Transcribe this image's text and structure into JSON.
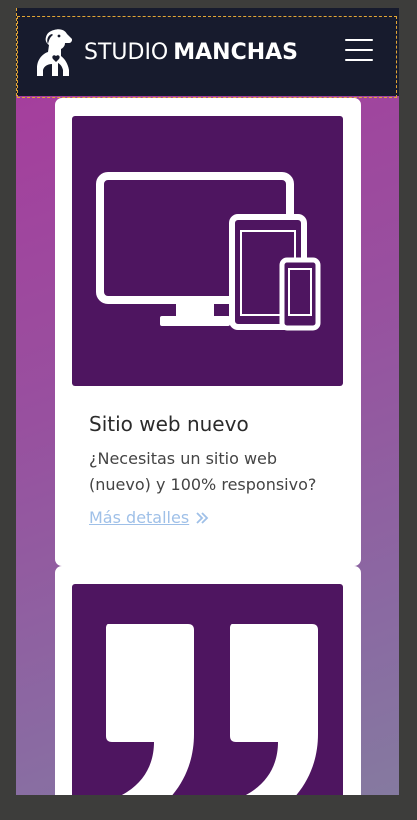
{
  "navbar": {
    "brand_light": "STUDIO",
    "brand_bold": "MANCHAS",
    "menu_icon": "hamburger-menu-icon",
    "logo_icon": "dog-logo-icon"
  },
  "cards": [
    {
      "icon": "devices-icon",
      "title": "Sitio web nuevo",
      "text": "¿Necesitas un sitio web (nuevo) y 100% responsivo?",
      "link": "Más detalles"
    },
    {
      "icon": "quote-icon"
    }
  ],
  "colors": {
    "navbar_bg": "#171b2d",
    "media_bg": "#4e1560",
    "link": "#9fc0e8",
    "gradient_start": "#a83a9c",
    "gradient_end": "#857aa0"
  }
}
